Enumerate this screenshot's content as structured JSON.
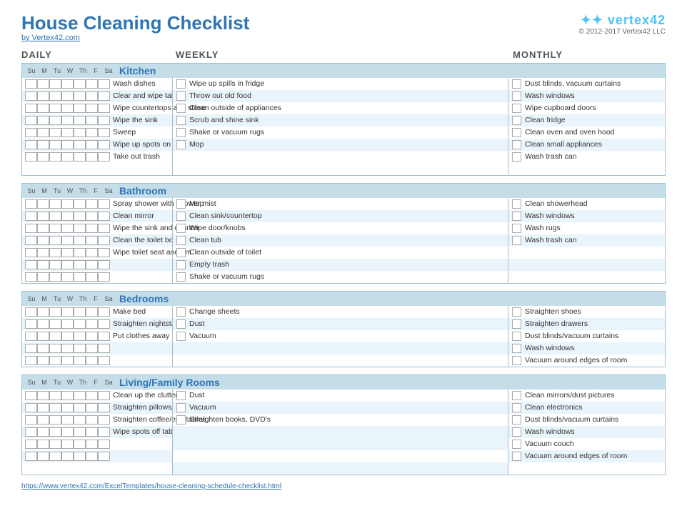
{
  "header": {
    "title": "House Cleaning Checklist",
    "subtitle": "by Vertex42.com",
    "logo_text": "vertex42",
    "copyright": "© 2012-2017 Vertex42 LLC"
  },
  "col_headers": {
    "daily": "DAILY",
    "weekly": "WEEKLY",
    "monthly": "MONTHLY"
  },
  "days": [
    "Su",
    "M",
    "Tu",
    "W",
    "Th",
    "F",
    "Sa"
  ],
  "sections": [
    {
      "name": "Kitchen",
      "daily_tasks": [
        {
          "text": "Wash dishes",
          "alt": false
        },
        {
          "text": "Clear and wipe table",
          "alt": true
        },
        {
          "text": "Wipe countertops and stove",
          "alt": false
        },
        {
          "text": "Wipe the sink",
          "alt": true
        },
        {
          "text": "Sweep",
          "alt": false
        },
        {
          "text": "Wipe up spots on the floor",
          "alt": true
        },
        {
          "text": "Take out trash",
          "alt": false
        }
      ],
      "weekly_tasks": [
        {
          "text": "Wipe up spills in fridge",
          "alt": false
        },
        {
          "text": "Throw out old food",
          "alt": true
        },
        {
          "text": "Clean outside of appliances",
          "alt": false
        },
        {
          "text": "Scrub and shine sink",
          "alt": true
        },
        {
          "text": "Shake or vacuum rugs",
          "alt": false
        },
        {
          "text": "Mop",
          "alt": true
        }
      ],
      "monthly_tasks": [
        {
          "text": "Dust blinds, vacuum curtains",
          "alt": false
        },
        {
          "text": "Wash windows",
          "alt": true
        },
        {
          "text": "Wipe cupboard doors",
          "alt": false
        },
        {
          "text": "Clean fridge",
          "alt": true
        },
        {
          "text": "Clean oven and oven hood",
          "alt": false
        },
        {
          "text": "Clean small appliances",
          "alt": true
        },
        {
          "text": "Wash trash can",
          "alt": false
        }
      ]
    },
    {
      "name": "Bathroom",
      "daily_tasks": [
        {
          "text": "Spray shower with shower mist",
          "alt": false
        },
        {
          "text": "Clean mirror",
          "alt": true
        },
        {
          "text": "Wipe the sink and counter",
          "alt": false
        },
        {
          "text": "Clean the toilet bowl",
          "alt": true
        },
        {
          "text": "Wipe toilet seat and rim",
          "alt": false
        }
      ],
      "weekly_tasks": [
        {
          "text": "Mop",
          "alt": false
        },
        {
          "text": "Clean sink/countertop",
          "alt": true
        },
        {
          "text": "Wipe door/knobs",
          "alt": false
        },
        {
          "text": "Clean tub",
          "alt": true
        },
        {
          "text": "Clean outside of toilet",
          "alt": false
        },
        {
          "text": "Empty trash",
          "alt": true
        },
        {
          "text": "Shake or vacuum rugs",
          "alt": false
        }
      ],
      "monthly_tasks": [
        {
          "text": "Clean showerhead",
          "alt": false
        },
        {
          "text": "Wash windows",
          "alt": true
        },
        {
          "text": "Wash rugs",
          "alt": false
        },
        {
          "text": "Wash trash can",
          "alt": true
        }
      ]
    },
    {
      "name": "Bedrooms",
      "daily_tasks": [
        {
          "text": "Make bed",
          "alt": false
        },
        {
          "text": "Straighten nightstand",
          "alt": true
        },
        {
          "text": "Put clothes away",
          "alt": false
        }
      ],
      "weekly_tasks": [
        {
          "text": "Change sheets",
          "alt": false
        },
        {
          "text": "Dust",
          "alt": true
        },
        {
          "text": "Vacuum",
          "alt": false
        }
      ],
      "monthly_tasks": [
        {
          "text": "Straighten shoes",
          "alt": false
        },
        {
          "text": "Straighten drawers",
          "alt": true
        },
        {
          "text": "Dust blinds/vacuum curtains",
          "alt": false
        },
        {
          "text": "Wash windows",
          "alt": true
        },
        {
          "text": "Vacuum around edges of room",
          "alt": false
        }
      ]
    },
    {
      "name": "Living/Family Rooms",
      "daily_tasks": [
        {
          "text": "Clean up the clutter",
          "alt": false
        },
        {
          "text": "Straighten pillows/cushions",
          "alt": true
        },
        {
          "text": "Straighten coffee/end tables",
          "alt": false
        },
        {
          "text": "Wipe spots off tables",
          "alt": true
        }
      ],
      "weekly_tasks": [
        {
          "text": "Dust",
          "alt": false
        },
        {
          "text": "Vacuum",
          "alt": true
        },
        {
          "text": "Straighten books, DVD's",
          "alt": false
        }
      ],
      "monthly_tasks": [
        {
          "text": "Clean mirrors/dust pictures",
          "alt": false
        },
        {
          "text": "Clean electronics",
          "alt": true
        },
        {
          "text": "Dust blinds/vacuum curtains",
          "alt": false
        },
        {
          "text": "Wash windows",
          "alt": true
        },
        {
          "text": "Vacuum couch",
          "alt": false
        },
        {
          "text": "Vacuum around edges of room",
          "alt": true
        }
      ]
    }
  ],
  "footer_url": "https://www.vertex42.com/ExcelTemplates/house-cleaning-schedule-checklist.html"
}
